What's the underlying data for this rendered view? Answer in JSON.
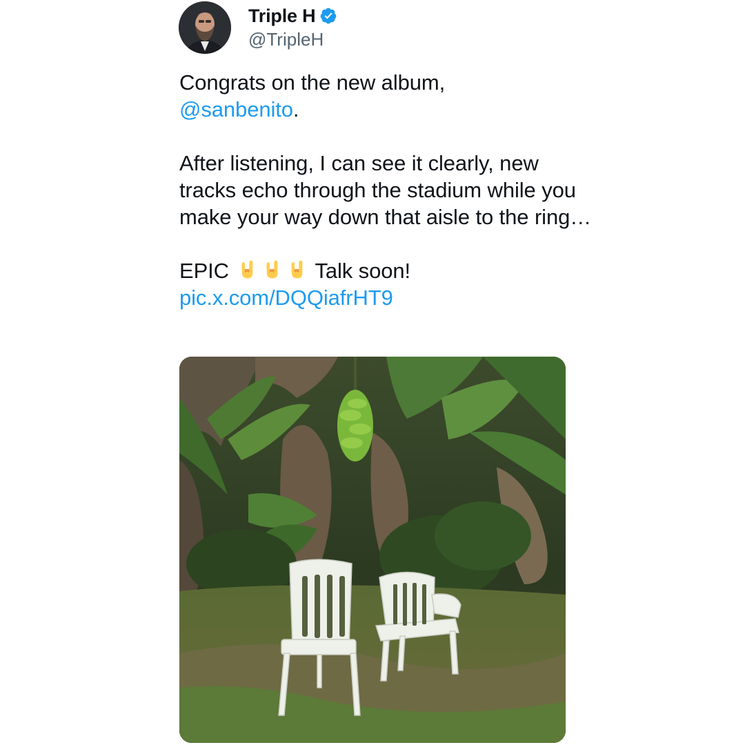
{
  "author": {
    "display_name": "Triple H",
    "handle": "@TripleH",
    "verified": true,
    "verified_badge_color": "#1d9bf0"
  },
  "tweet": {
    "line1_text": "Congrats on the new album,",
    "mention": "@sanbenito",
    "mention_suffix": ".",
    "paragraph2": "After listening, I can see it clearly, new tracks echo through the stadium while you make your way down that aisle to the ring…",
    "line3_prefix": "EPIC",
    "emoji": [
      "sign-of-the-horns",
      "sign-of-the-horns",
      "sign-of-the-horns"
    ],
    "line3_suffix": "Talk soon!",
    "pic_link": "pic.x.com/DQQiafrHT9",
    "link_color": "#1d9bf0"
  },
  "media": {
    "icon": "photo-banana-grove-two-white-chairs"
  }
}
